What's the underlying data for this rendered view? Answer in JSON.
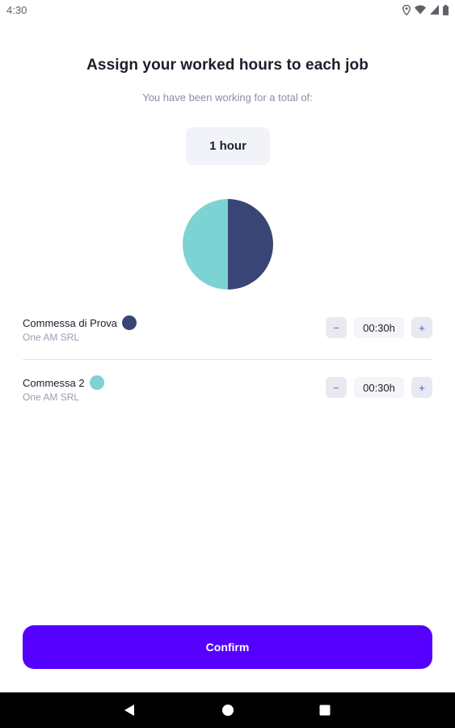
{
  "status_bar": {
    "time": "4:30",
    "icons": [
      "location-icon",
      "wifi-icon",
      "signal-icon",
      "battery-icon"
    ]
  },
  "header": {
    "title": "Assign your worked hours to each job",
    "subtitle": "You have been working for a total of:",
    "total": "1 hour"
  },
  "jobs": [
    {
      "name": "Commessa di Prova",
      "company": "One AM SRL",
      "color": "#394675",
      "time": "00:30h",
      "minus_label": "−",
      "plus_label": "+",
      "share": 0.5
    },
    {
      "name": "Commessa 2",
      "company": "One AM SRL",
      "color": "#7dd3d3",
      "time": "00:30h",
      "minus_label": "−",
      "plus_label": "+",
      "share": 0.5
    }
  ],
  "confirm": {
    "label": "Confirm",
    "color": "#5500ff"
  },
  "nav": {
    "icons": [
      "back-icon",
      "home-icon",
      "recents-icon"
    ]
  }
}
